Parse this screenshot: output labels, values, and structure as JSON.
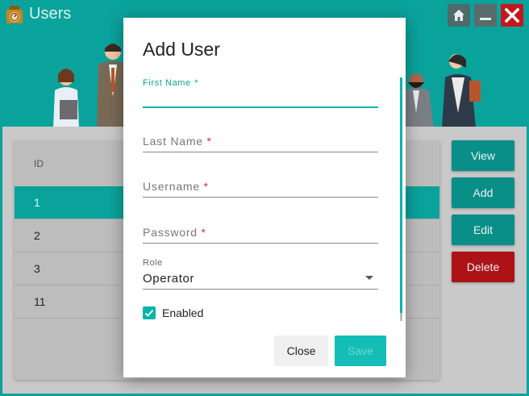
{
  "window": {
    "title": "Users"
  },
  "table": {
    "header_id": "ID",
    "rows": [
      {
        "id": "1"
      },
      {
        "id": "2"
      },
      {
        "id": "3"
      },
      {
        "id": "11"
      }
    ]
  },
  "actions": {
    "view": "View",
    "add": "Add",
    "edit": "Edit",
    "delete": "Delete"
  },
  "dialog": {
    "title": "Add User",
    "first_name_label": "First Name",
    "last_name_label": "Last Name",
    "username_label": "Username",
    "password_label": "Password",
    "required_mark": "*",
    "role_label": "Role",
    "role_value": "Operator",
    "enabled_label": "Enabled",
    "enabled_checked": true,
    "close_label": "Close",
    "save_label": "Save"
  },
  "colors": {
    "accent": "#0aa39c",
    "danger": "#ad1216",
    "required": "#d43030"
  }
}
